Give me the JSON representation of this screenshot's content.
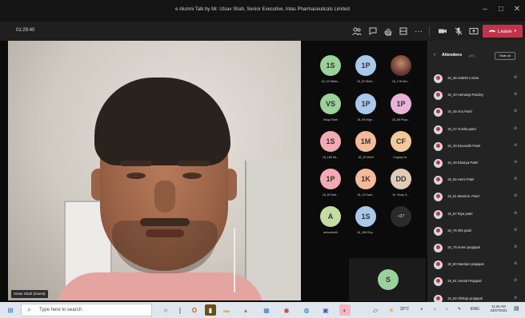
{
  "window": {
    "title": "e Alumni Talk by Mr. Utsav Shah, Senior Executive, Intas Pharmaceuticals Limited",
    "min": "–",
    "max": "□",
    "close": "✕"
  },
  "toolbar": {
    "timer": "01:29:40",
    "leave_label": "Leave",
    "more_label": "···"
  },
  "video": {
    "speaker_name": "Utsav Shah (Guest)"
  },
  "gallery": [
    {
      "initials": "1S",
      "label": "18_15 Nikita...",
      "color": "#9bd19b"
    },
    {
      "initials": "1P",
      "label": "18_52 Nimit...",
      "color": "#a9c8ea"
    },
    {
      "initials": "",
      "label": "18_178 Ano...",
      "color": "photo"
    },
    {
      "initials": "VS",
      "label": "Virugi Shah",
      "color": "#9bd19b"
    },
    {
      "initials": "1P",
      "label": "18_98 hilge...",
      "color": "#a9c8ea"
    },
    {
      "initials": "1P",
      "label": "18_88 Priya...",
      "color": "#e8b3d6"
    },
    {
      "initials": "1S",
      "label": "18_188 Ha...",
      "color": "#f4a9b3"
    },
    {
      "initials": "1M",
      "label": "18_10 Mohit",
      "color": "#f6b999"
    },
    {
      "initials": "CF",
      "label": "Cognizy fe...",
      "color": "#f3c99a"
    },
    {
      "initials": "1P",
      "label": "18_83 Dad...",
      "color": "#f4a9b3"
    },
    {
      "initials": "1K",
      "label": "18_13 Dadi...",
      "color": "#f6b999"
    },
    {
      "initials": "DD",
      "label": "Dr. Vinay D...",
      "color": "#e0ccb5"
    },
    {
      "initials": "A",
      "label": "anksubartil",
      "color": "#c5dca0"
    },
    {
      "initials": "1S",
      "label": "18_186 Dhy...",
      "color": "#a9c8ea"
    },
    {
      "initials": "+37",
      "label": "",
      "color": "more"
    }
  ],
  "share_tile": {
    "initials": "S",
    "color": "#9bd19b"
  },
  "attendees": {
    "title": "Attendees",
    "count": "(47)",
    "mute_all": "Mute all",
    "list": [
      {
        "name": "18_35 Adarsh Losiva"
      },
      {
        "name": "18_43 Hemangi Pandey"
      },
      {
        "name": "18_46 Anu Patel"
      },
      {
        "name": "18_47 Anisha patel"
      },
      {
        "name": "18_49 Devanshi Patel"
      },
      {
        "name": "18_49 Dhairya Patel"
      },
      {
        "name": "18_55 Hemi Patel"
      },
      {
        "name": "18_61 Mansi B. Patel"
      },
      {
        "name": "18_67 Riya patel"
      },
      {
        "name": "18_76 Irith patel"
      },
      {
        "name": "18_79 Arven prajapati"
      },
      {
        "name": "18_80 Nandani prajapati"
      },
      {
        "name": "18_81 Unnati Prajapati"
      },
      {
        "name": "18_82 Vibhuja prajapati"
      }
    ]
  },
  "taskbar": {
    "search_placeholder": "Type here to search",
    "temperature": "32°C",
    "language": "ENG",
    "time": "11:26 AM",
    "date": "23/07/2021"
  }
}
